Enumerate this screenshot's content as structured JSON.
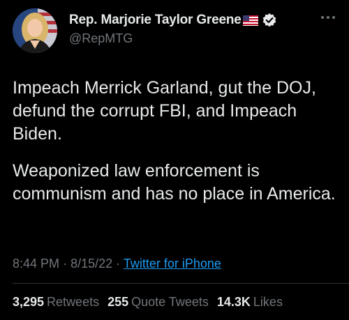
{
  "header": {
    "display_name": "Rep. Marjorie Taylor Greene",
    "handle": "@RepMTG",
    "flag_icon": "us-flag-icon",
    "verified_icon": "verified-badge-icon",
    "more_icon": "more-options-icon"
  },
  "tweet": {
    "paragraphs": [
      "Impeach Merrick Garland, gut the DOJ, defund the corrupt FBI, and Impeach Biden.",
      "Weaponized law enforcement is communism and has no place in America."
    ]
  },
  "meta": {
    "time": "8:44 PM",
    "separator": "·",
    "date": "8/15/22",
    "source": "Twitter for iPhone"
  },
  "stats": {
    "retweets_count": "3,295",
    "retweets_label": "Retweets",
    "quotes_count": "255",
    "quotes_label": "Quote Tweets",
    "likes_count": "14.3K",
    "likes_label": "Likes"
  },
  "colors": {
    "background": "#000000",
    "primary_text": "#e7e9ea",
    "secondary_text": "#71767b",
    "link": "#1d9bf0",
    "divider": "#2f3336"
  }
}
